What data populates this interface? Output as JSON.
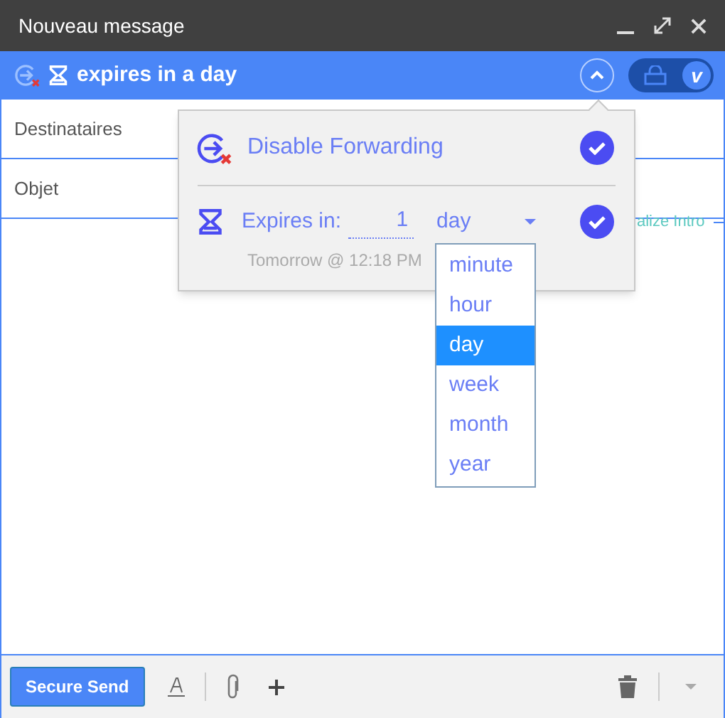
{
  "window": {
    "title": "Nouveau message"
  },
  "banner": {
    "text": "expires in a day",
    "secure_toggle": {
      "on": true,
      "knob_letter": "v"
    }
  },
  "fields": [
    {
      "label": "Destinataires"
    },
    {
      "label": "Objet"
    }
  ],
  "intro_link": "alize Intro",
  "popup": {
    "options": [
      {
        "kind": "forwarding",
        "label": "Disable Forwarding",
        "checked": true
      },
      {
        "kind": "expiry",
        "label": "Expires in:",
        "value": "1",
        "unit": "day",
        "note": "Tomorrow @ 12:18 PM",
        "checked": true
      }
    ]
  },
  "unit_menu": [
    {
      "label": "minute",
      "selected": false
    },
    {
      "label": "hour",
      "selected": false
    },
    {
      "label": "day",
      "selected": true
    },
    {
      "label": "week",
      "selected": false
    },
    {
      "label": "month",
      "selected": false
    },
    {
      "label": "year",
      "selected": false
    }
  ],
  "toolbar": {
    "send_button": "Secure Send"
  }
}
